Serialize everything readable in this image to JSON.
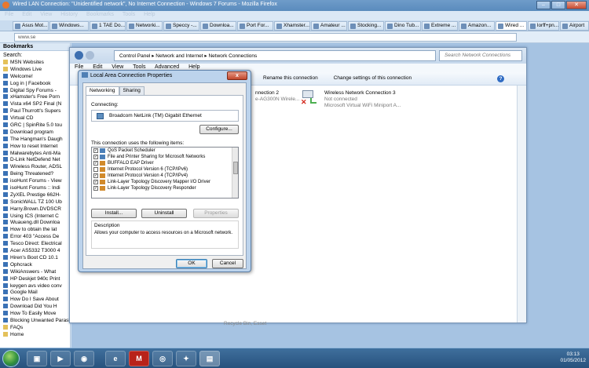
{
  "firefox": {
    "title": "Wired LAN Connection: \"Unidentified network\", No Internet Connection - Windows 7 Forums - Mozilla Firefox",
    "menu": [
      "File",
      "Edit",
      "View",
      "History",
      "Bookmarks",
      "Tools",
      "Help"
    ],
    "tabs": [
      "Asus Mot...",
      "Windows...",
      "1 TAE Do...",
      "Networki...",
      "Speccy -...",
      "Downloa...",
      "Port For...",
      "Xhamster...",
      "Amateur ...",
      "Stocking...",
      "Dino Tub...",
      "Extreme ...",
      "Amazon...",
      "Wired ...",
      "lorff+pn...",
      "Airport"
    ],
    "url": "www.se"
  },
  "sidebar": {
    "heading": "Bookmarks",
    "search_label": "Search:",
    "items": [
      "MSN Websites",
      "Windows Live",
      "Welcome!",
      "Log in | Facebook",
      "Digital Spy Forums -",
      "xHamster's Free Porn",
      "Vista x64 SP2 Final (N",
      "Paul Thurrott's Supers",
      "Virtual CD",
      "GRC | SpinRite 5.0 tou",
      "Download program",
      "The Hangman's Daugh",
      "How to reset Internet",
      "Malwarebytes Anti-Ma",
      "D-Link NetDefend Net",
      "Wireless Router, ADSL",
      "Being Threatened?",
      "isoHunt Forums - View",
      "isoHunt Forums :: Indi",
      "ZyXEL Prestige 662H-",
      "SonicWALL TZ 100 Ub",
      "Harry.Brown.DVDSCR",
      "Using ICS (Internet C",
      "Wuaueng.dll Downloa",
      "How to obtain the lat",
      "Error 403 \"Access De",
      "Tesco Direct: Electrical",
      "Acer AS5332 T3000 4",
      "Hiren's Boot CD 10.1",
      "Ophcrack",
      "WikiAnswers - What",
      "HP Deskjet 940c Print",
      "keygen avs video conv",
      "Google Mail",
      "How Do I Save About",
      "Download Did You H",
      "How To Easily Move",
      "Blocking Unwanted Parasites with a Hosts File",
      "FAQs",
      "Home"
    ]
  },
  "explorer": {
    "breadcrumb": [
      "Control Panel",
      "Network and Internet",
      "Network Connections"
    ],
    "search_placeholder": "Search Network Connections",
    "menu": [
      "File",
      "Edit",
      "View",
      "Tools",
      "Advanced",
      "Help"
    ],
    "commands": [
      "Rename this connection",
      "Change settings of this connection"
    ],
    "connection_left": {
      "name": "nnection 2",
      "status": "e-AG300N Wirele..."
    },
    "connection_right": {
      "name": "Wireless Network Connection 3",
      "status": "Not connected",
      "device": "Microsoft Virtual WiFi Miniport A..."
    },
    "bottom_text": "Recycle Bin, Esset"
  },
  "dialog": {
    "title": "Local Area Connection Properties",
    "close_label": "x",
    "tabs": [
      "Networking",
      "Sharing"
    ],
    "connect_using_label": "Connecting:",
    "adapter": "Broadcom NetLink (TM) Gigabit Ethernet",
    "configure_label": "Configure...",
    "items_label": "This connection uses the following items:",
    "items": [
      {
        "label": "QoS Packet Scheduler",
        "checked": "✓"
      },
      {
        "label": "File and Printer Sharing for Microsoft Networks",
        "checked": "✓"
      },
      {
        "label": "BUFFALO EAP Driver",
        "checked": "✓"
      },
      {
        "label": "Internet Protocol Version 6 (TCP/IPv6)",
        "checked": ""
      },
      {
        "label": "Internet Protocol Version 4 (TCP/IPv4)",
        "checked": "✓"
      },
      {
        "label": "Link-Layer Topology Discovery Mapper I/O Driver",
        "checked": "✓"
      },
      {
        "label": "Link-Layer Topology Discovery Responder",
        "checked": "✓"
      }
    ],
    "install_label": "Install...",
    "uninstall_label": "Uninstall",
    "properties_label": "Properties",
    "description_title": "Description",
    "description": "Allows your computer to access resources on a Microsoft network.",
    "ok_label": "OK",
    "cancel_label": "Cancel"
  },
  "taskbar": {
    "apps": [
      "e",
      "M"
    ],
    "time": "03:13",
    "date": "01/05/2012"
  }
}
